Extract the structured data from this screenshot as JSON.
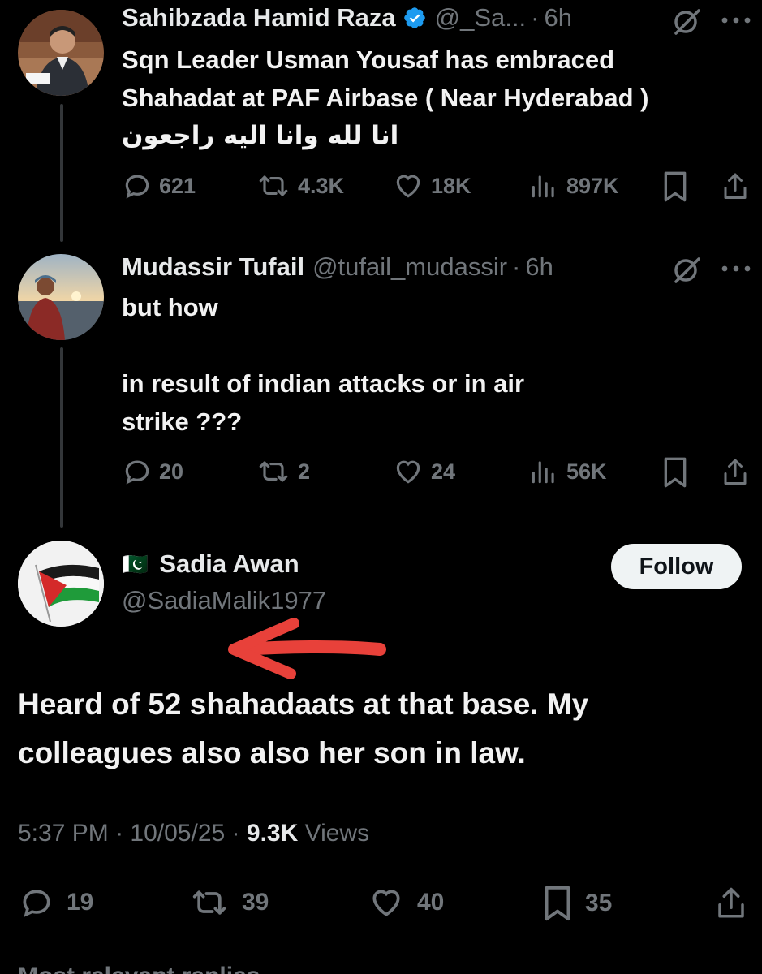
{
  "tweets": [
    {
      "name": "Sahibzada Hamid Raza",
      "verified": true,
      "handle": "@_Sa...",
      "dot": "·",
      "time": "6h",
      "text": "Sqn Leader Usman Yousaf has embraced\nShahadat at PAF Airbase ( Near Hyderabad )",
      "text_urdu": "انا لله وانا اليه راجعون",
      "replies": "621",
      "reposts": "4.3K",
      "likes": "18K",
      "views": "897K"
    },
    {
      "name": "Mudassir Tufail",
      "handle": "@tufail_mudassir",
      "dot": "·",
      "time": "6h",
      "text": "but how\n\nin result of indian attacks or in air\nstrike ???",
      "replies": "20",
      "reposts": "2",
      "likes": "24",
      "views": "56K"
    }
  ],
  "main_tweet": {
    "flag": "🇵🇰",
    "name": "Sadia Awan",
    "handle": "@SadiaMalik1977",
    "follow_label": "Follow",
    "text": "Heard of 52 shahadaats at that base. My colleagues also also her son in law.",
    "time": "5:37 PM",
    "date": "10/05/25",
    "views_count": "9.3K",
    "views_label": "Views",
    "dot": "·",
    "replies": "19",
    "reposts": "39",
    "likes": "40",
    "bookmarks": "35"
  },
  "cut_text": "Most relevant replies",
  "icons": [
    "verified-badge-icon",
    "grok-icon",
    "more-icon",
    "reply-icon",
    "repost-icon",
    "like-icon",
    "views-icon",
    "bookmark-icon",
    "share-icon",
    "red-arrow"
  ],
  "colors": {
    "background": "#000000",
    "text": "#e7e9ea",
    "muted": "#71767b",
    "verified": "#1d9bf0",
    "arrow": "#e8413a",
    "follow_bg": "#eff3f4"
  }
}
